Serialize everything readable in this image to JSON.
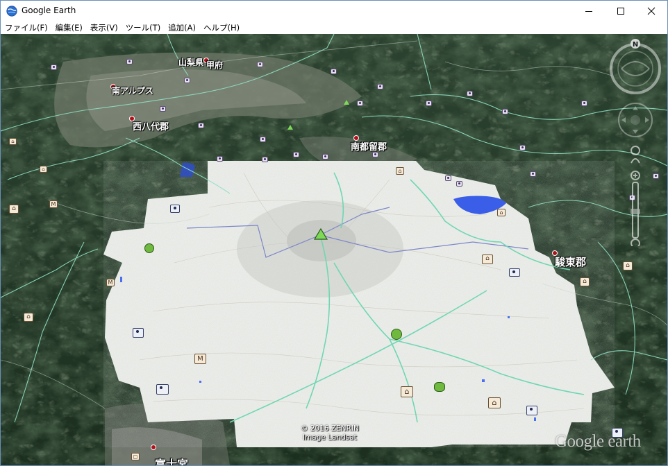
{
  "window": {
    "title": "Google Earth",
    "controls": {
      "minimize": "minimize",
      "maximize": "maximize",
      "close": "close"
    }
  },
  "menu": {
    "items": [
      {
        "label": "ファイル(F)"
      },
      {
        "label": "編集(E)"
      },
      {
        "label": "表示(V)"
      },
      {
        "label": "ツール(T)"
      },
      {
        "label": "追加(A)"
      },
      {
        "label": "ヘルプ(H)"
      }
    ]
  },
  "map": {
    "places": [
      {
        "name": "山梨県",
        "key": "yamanashi"
      },
      {
        "name": "甲府",
        "key": "kofu"
      },
      {
        "name": "南アルプス",
        "key": "minami-alps"
      },
      {
        "name": "西八代郡",
        "key": "nishiyatsushiro"
      },
      {
        "name": "南都留郡",
        "key": "minamitsuru"
      },
      {
        "name": "駿東郡",
        "key": "sunto"
      },
      {
        "name": "富士宮",
        "key": "fujinomiya"
      }
    ],
    "copyright": "© 2016 ZENRIN",
    "imagery": "Image Landsat",
    "watermark": "Google earth"
  },
  "navigation": {
    "north_label": "N",
    "icons": [
      "compass-icon",
      "look-joystick-icon",
      "move-joystick-icon",
      "street-view-icon",
      "zoom-slider-icon"
    ]
  },
  "colors": {
    "terrain_dark": "#1f3322",
    "terrain_mid": "#3c5636",
    "road_cyan": "#8fe0c4",
    "boundary_blue": "#7d86c9",
    "lake_blue": "#3a5ee8",
    "city_red": "#b0101a"
  }
}
